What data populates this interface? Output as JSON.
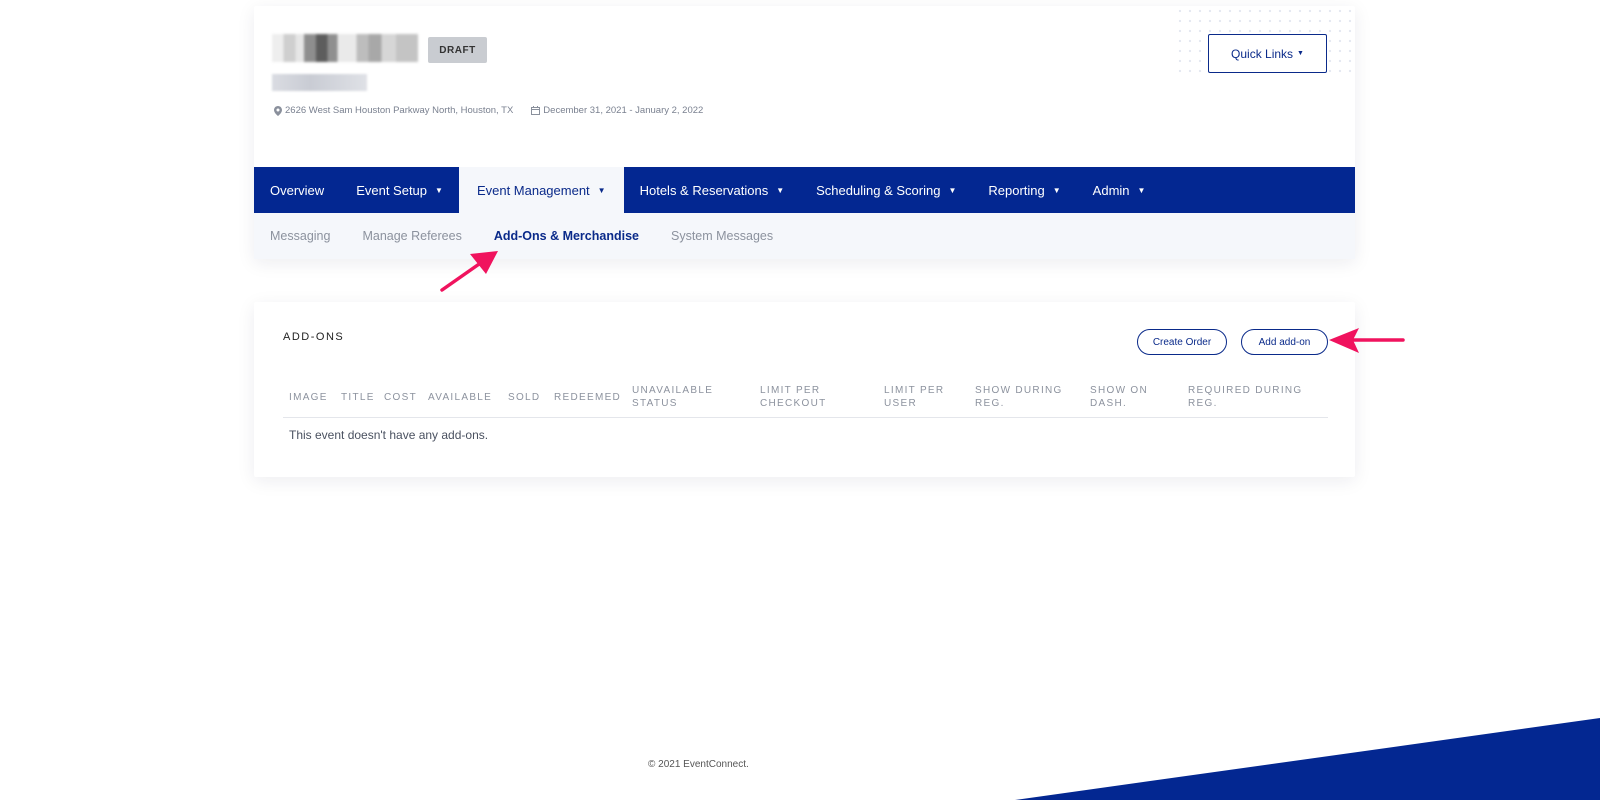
{
  "event": {
    "status_badge": "DRAFT",
    "address": "2626 West Sam Houston Parkway North, Houston, TX",
    "dates": "December 31, 2021 - January 2, 2022"
  },
  "header": {
    "quick_links_label": "Quick Links"
  },
  "nav": {
    "items": [
      {
        "label": "Overview"
      },
      {
        "label": "Event Setup"
      },
      {
        "label": "Event Management"
      },
      {
        "label": "Hotels & Reservations"
      },
      {
        "label": "Scheduling & Scoring"
      },
      {
        "label": "Reporting"
      },
      {
        "label": "Admin"
      }
    ],
    "active": "Event Management"
  },
  "subnav": {
    "items": [
      {
        "label": "Messaging"
      },
      {
        "label": "Manage Referees"
      },
      {
        "label": "Add-Ons & Merchandise"
      },
      {
        "label": "System Messages"
      }
    ],
    "active": "Add-Ons & Merchandise"
  },
  "addons": {
    "title": "ADD-ONS",
    "create_order_label": "Create Order",
    "add_addon_label": "Add add-on",
    "columns": [
      "IMAGE",
      "TITLE",
      "COST",
      "AVAILABLE",
      "SOLD",
      "REDEEMED",
      "UNAVAILABLE STATUS",
      "LIMIT PER CHECKOUT",
      "LIMIT PER USER",
      "SHOW DURING REG.",
      "SHOW ON DASH.",
      "REQUIRED DURING REG."
    ],
    "empty_message": "This event doesn't have any add-ons."
  },
  "footer": {
    "copyright": "© 2021 EventConnect."
  },
  "colors": {
    "brand_navy": "#032791",
    "accent_pink": "#f0135e",
    "badge_gray": "#c9ccd1"
  },
  "icons": {
    "location": "map-marker-icon",
    "date": "calendar-icon",
    "dropdown": "caret-down-icon"
  }
}
